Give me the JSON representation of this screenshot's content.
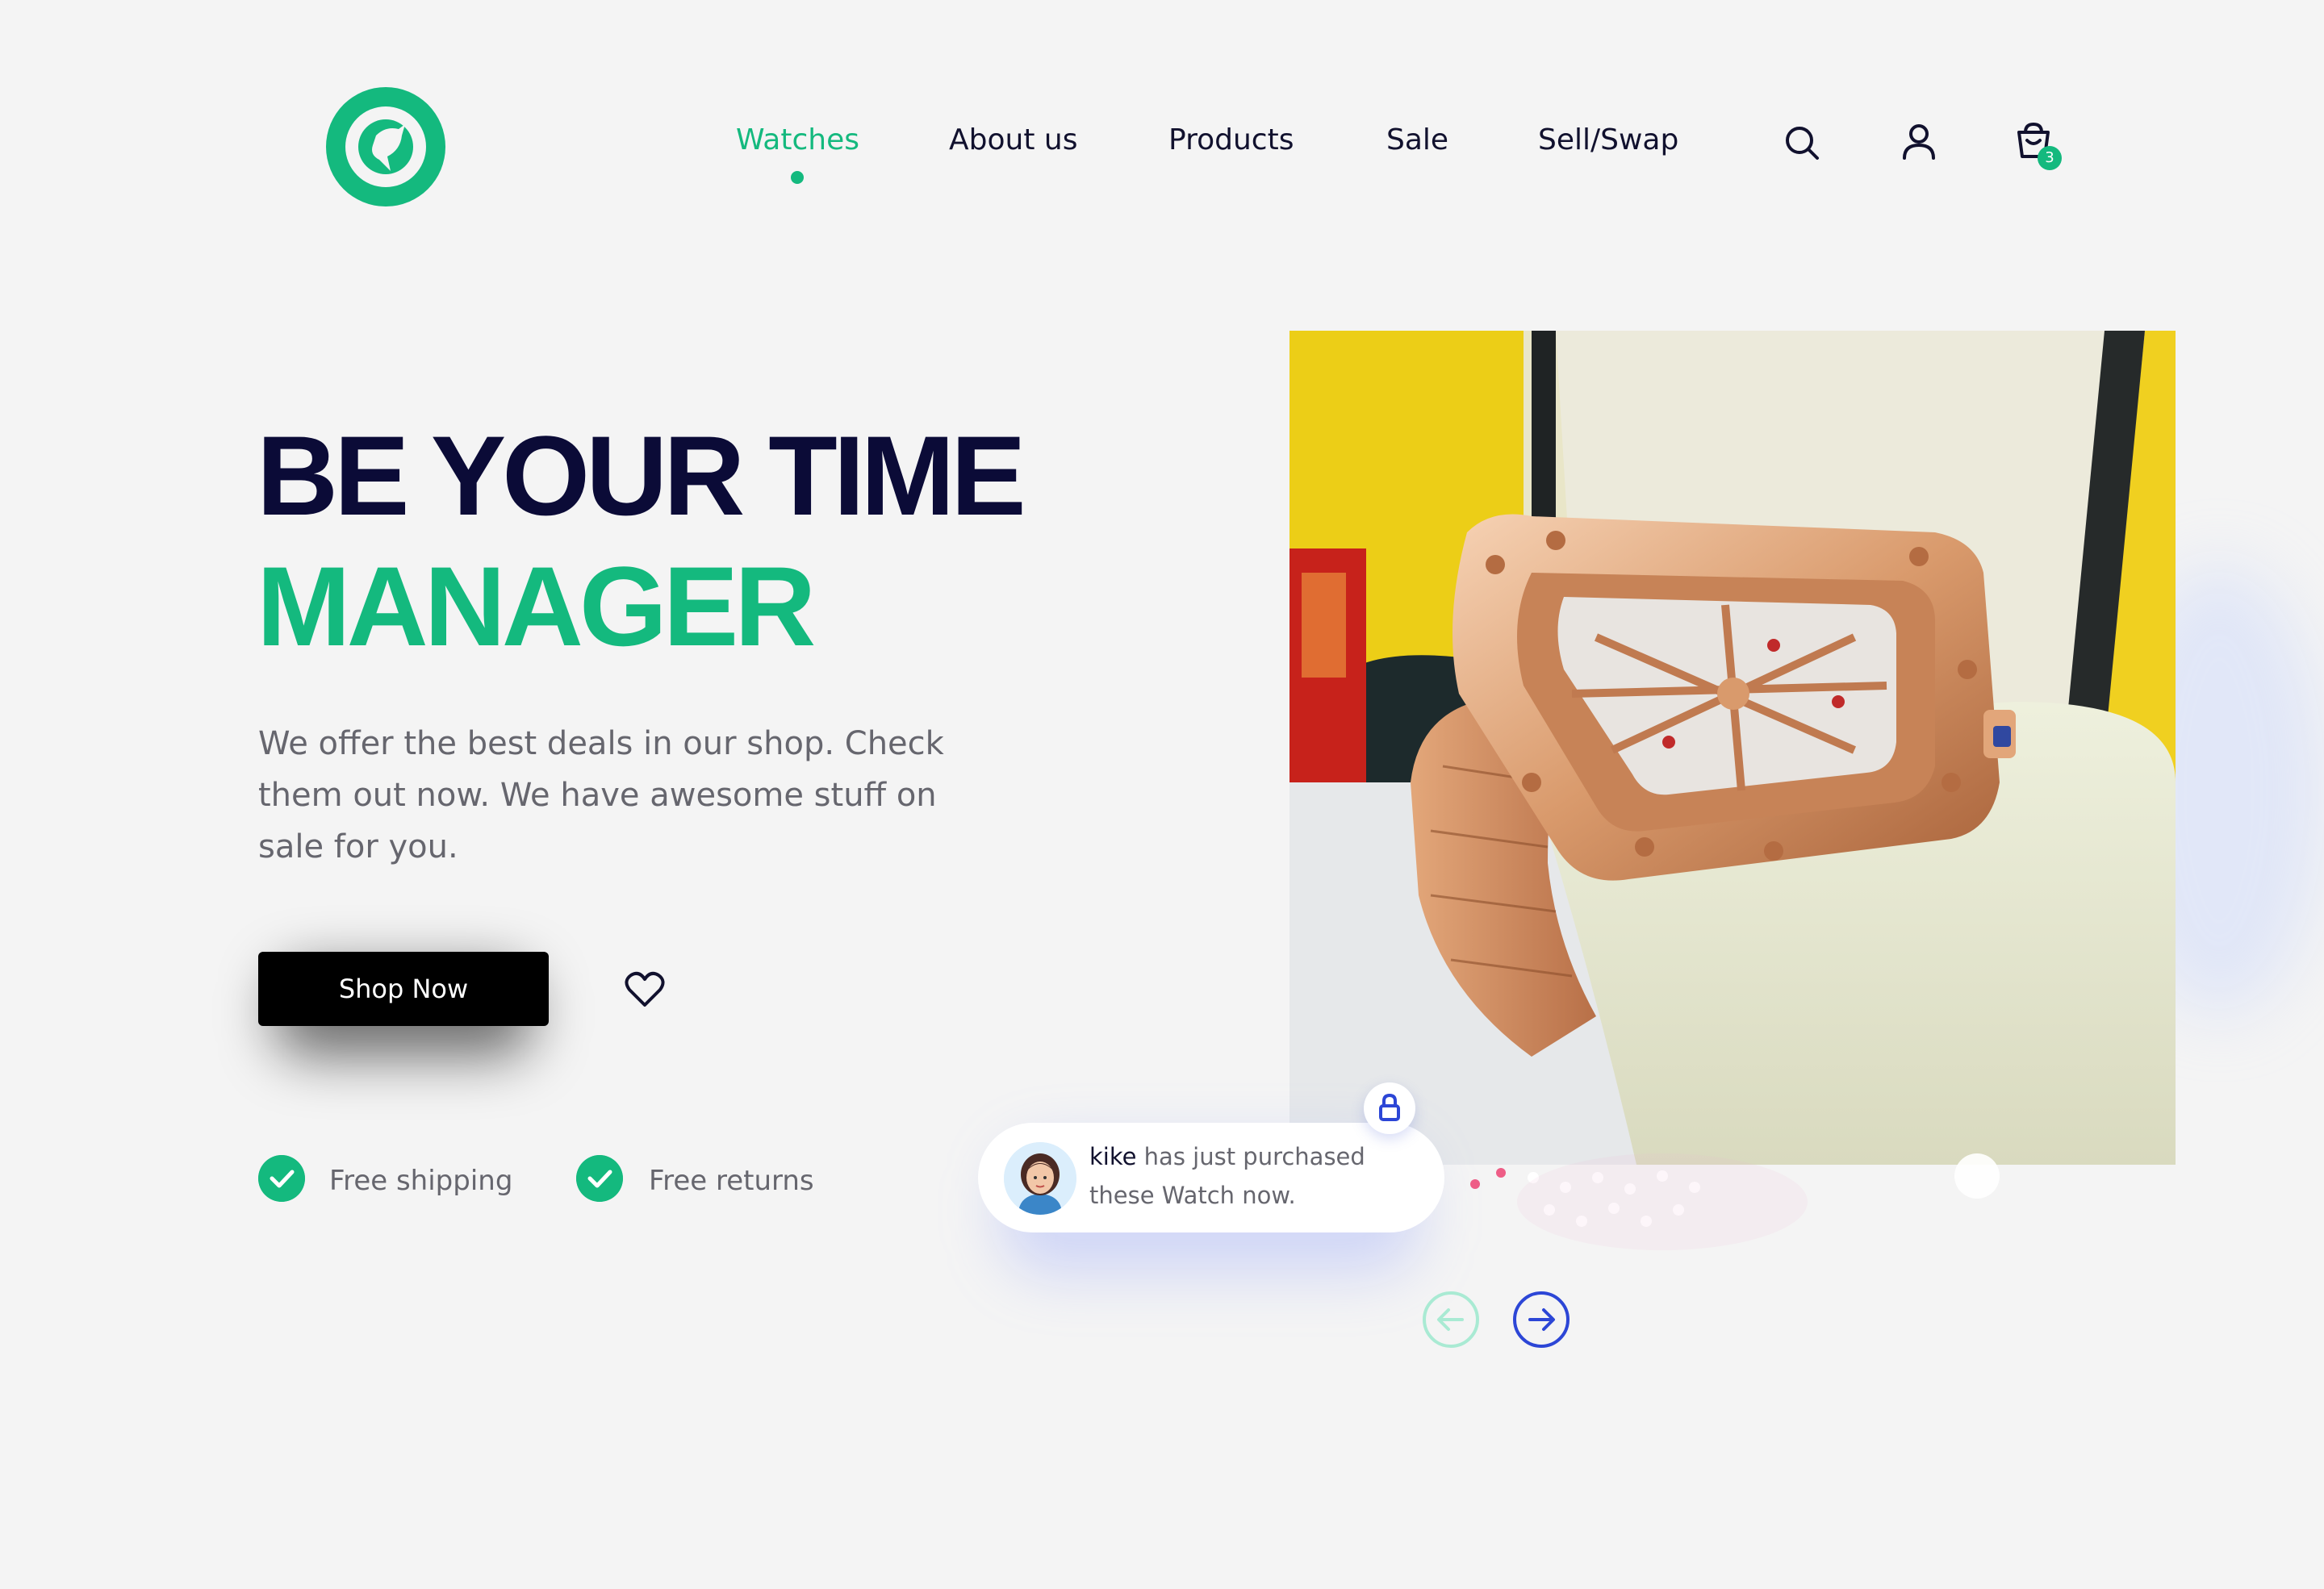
{
  "header": {
    "logo_icon": "brand-logo-icon",
    "nav": [
      {
        "label": "Watches",
        "active": true
      },
      {
        "label": "About us",
        "active": false
      },
      {
        "label": "Products",
        "active": false
      },
      {
        "label": "Sale",
        "active": false
      },
      {
        "label": "Sell/Swap",
        "active": false
      }
    ],
    "icons": [
      "search-icon",
      "user-icon",
      "cart-icon"
    ],
    "cart_count": "3"
  },
  "hero": {
    "headline_line1": "BE YOUR TIME",
    "headline_line2": "MANAGER",
    "description": "We offer the best deals in our shop. Check them out now. We have awesome stuff on sale for you.",
    "shop_button": "Shop Now",
    "features": [
      "Free shipping",
      "Free returns"
    ]
  },
  "notification": {
    "name": "kike",
    "line1_rest": " has just purchased",
    "line2": "these Watch now."
  },
  "colors": {
    "accent": "#14b97e",
    "dark": "#0b0b37",
    "arrow_blue": "#2c46d6"
  }
}
